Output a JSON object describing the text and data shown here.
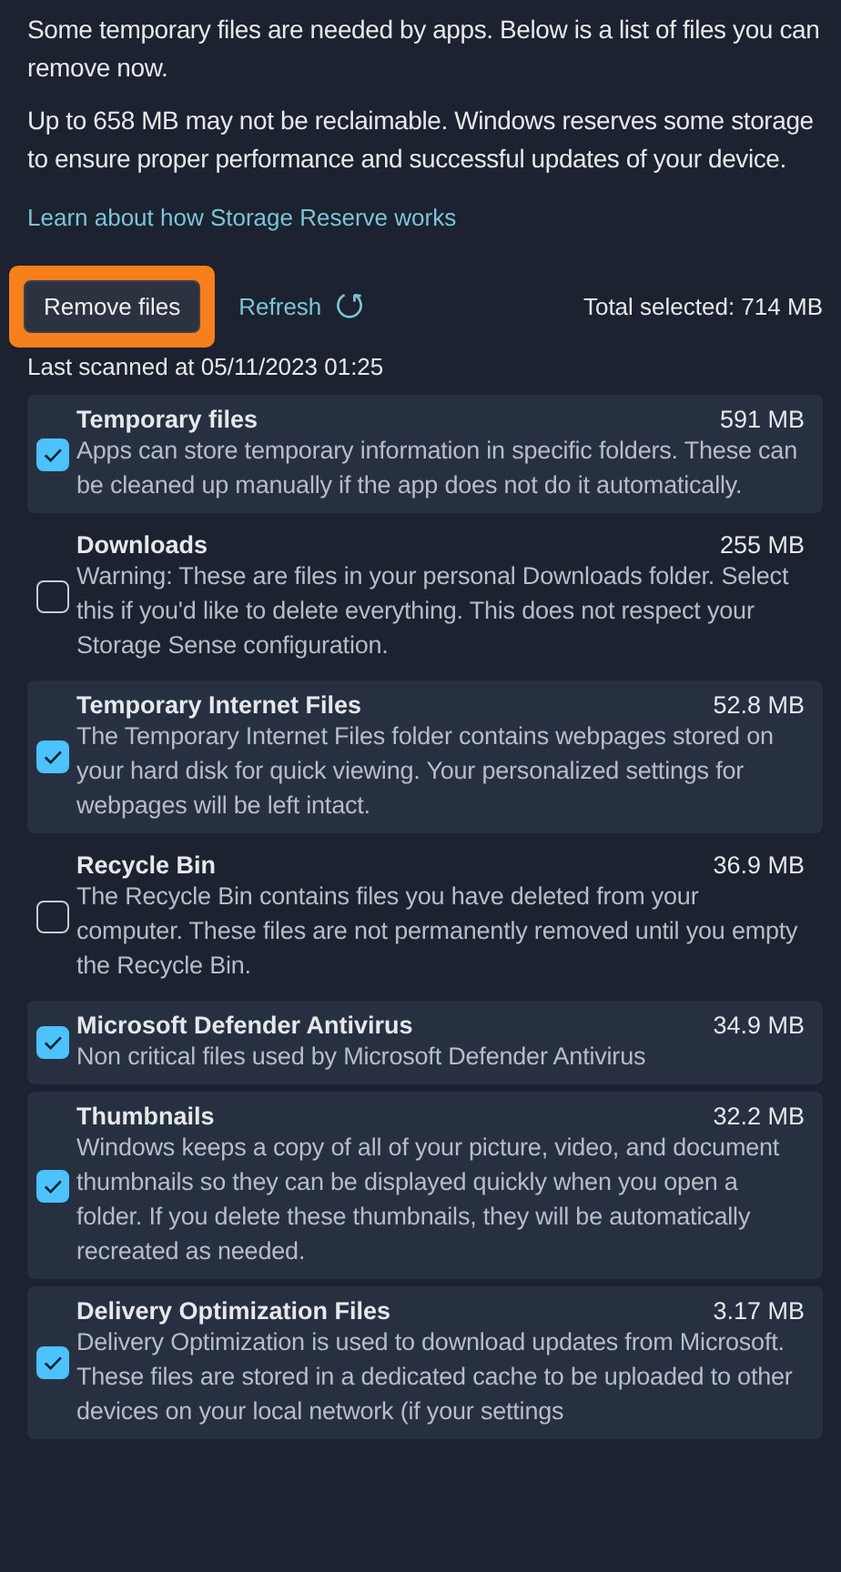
{
  "intro": [
    "Some temporary files are needed by apps. Below is a list of files you can remove now.",
    "Up to 658 MB may not be reclaimable. Windows reserves some storage to ensure proper performance and successful updates of your device."
  ],
  "learn_link": "Learn about how Storage Reserve works",
  "actions": {
    "remove_button": {
      "label": "Remove files",
      "highlighted": true
    },
    "refresh_link": "Refresh",
    "total_selected": "Total selected: 714 MB"
  },
  "last_scanned": "Last scanned at 05/11/2023 01:25",
  "items": [
    {
      "title": "Temporary files",
      "size": "591 MB",
      "description": "Apps can store temporary information in specific folders. These can be cleaned up manually if the app does not do it automatically.",
      "checked": true
    },
    {
      "title": "Downloads",
      "size": "255 MB",
      "description": "Warning: These are files in your personal Downloads folder. Select this if you'd like to delete everything. This does not respect your Storage Sense configuration.",
      "checked": false
    },
    {
      "title": "Temporary Internet Files",
      "size": "52.8 MB",
      "description": "The Temporary Internet Files folder contains webpages stored on your hard disk for quick viewing. Your personalized settings for webpages will be left intact.",
      "checked": true
    },
    {
      "title": "Recycle Bin",
      "size": "36.9 MB",
      "description": "The Recycle Bin contains files you have deleted from your computer. These files are not permanently removed until you empty the Recycle Bin.",
      "checked": false
    },
    {
      "title": "Microsoft Defender Antivirus",
      "size": "34.9 MB",
      "description": "Non critical files used by Microsoft Defender Antivirus",
      "checked": true
    },
    {
      "title": "Thumbnails",
      "size": "32.2 MB",
      "description": "Windows keeps a copy of all of your picture, video, and document thumbnails so they can be displayed quickly when you open a folder. If you delete these thumbnails, they will be automatically recreated as needed.",
      "checked": true
    },
    {
      "title": "Delivery Optimization Files",
      "size": "3.17 MB",
      "description": "Delivery Optimization is used to download updates from Microsoft. These files are stored in a dedicated cache to be uploaded to other devices on your local network (if your settings",
      "checked": true
    }
  ]
}
